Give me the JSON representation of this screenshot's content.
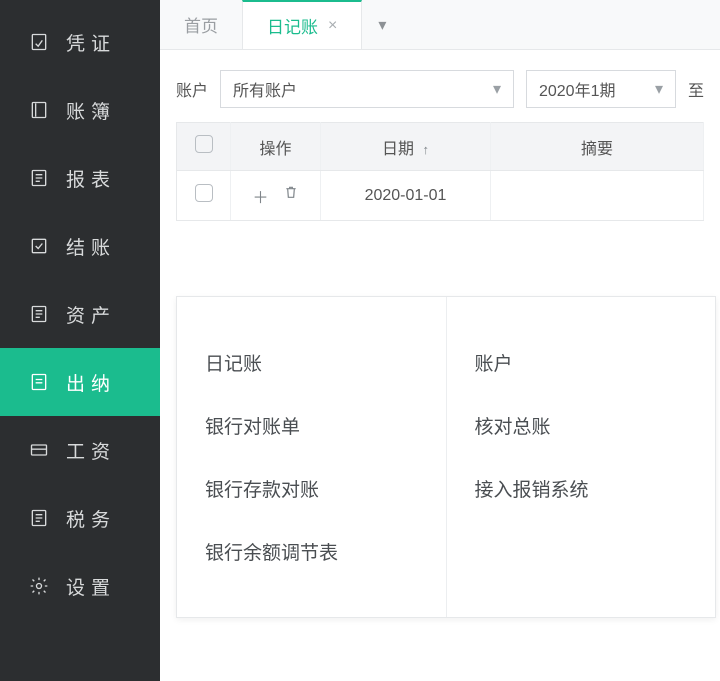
{
  "sidebar": {
    "items": [
      {
        "label": "凭证"
      },
      {
        "label": "账簿"
      },
      {
        "label": "报表"
      },
      {
        "label": "结账"
      },
      {
        "label": "资产"
      },
      {
        "label": "出纳"
      },
      {
        "label": "工资"
      },
      {
        "label": "税务"
      },
      {
        "label": "设置"
      }
    ],
    "activeIndex": 5
  },
  "tabs": {
    "home": "首页",
    "active": "日记账"
  },
  "filters": {
    "accountLabel": "账户",
    "accountValue": "所有账户",
    "periodValue": "2020年1期",
    "tail": "至"
  },
  "table": {
    "headers": {
      "op": "操作",
      "date": "日期",
      "summary": "摘要"
    },
    "rows": [
      {
        "date": "2020-01-01",
        "summary": ""
      }
    ]
  },
  "flyout": {
    "left": [
      "日记账",
      "银行对账单",
      "银行存款对账",
      "银行余额调节表"
    ],
    "right": [
      "账户",
      "核对总账",
      "接入报销系统"
    ]
  }
}
